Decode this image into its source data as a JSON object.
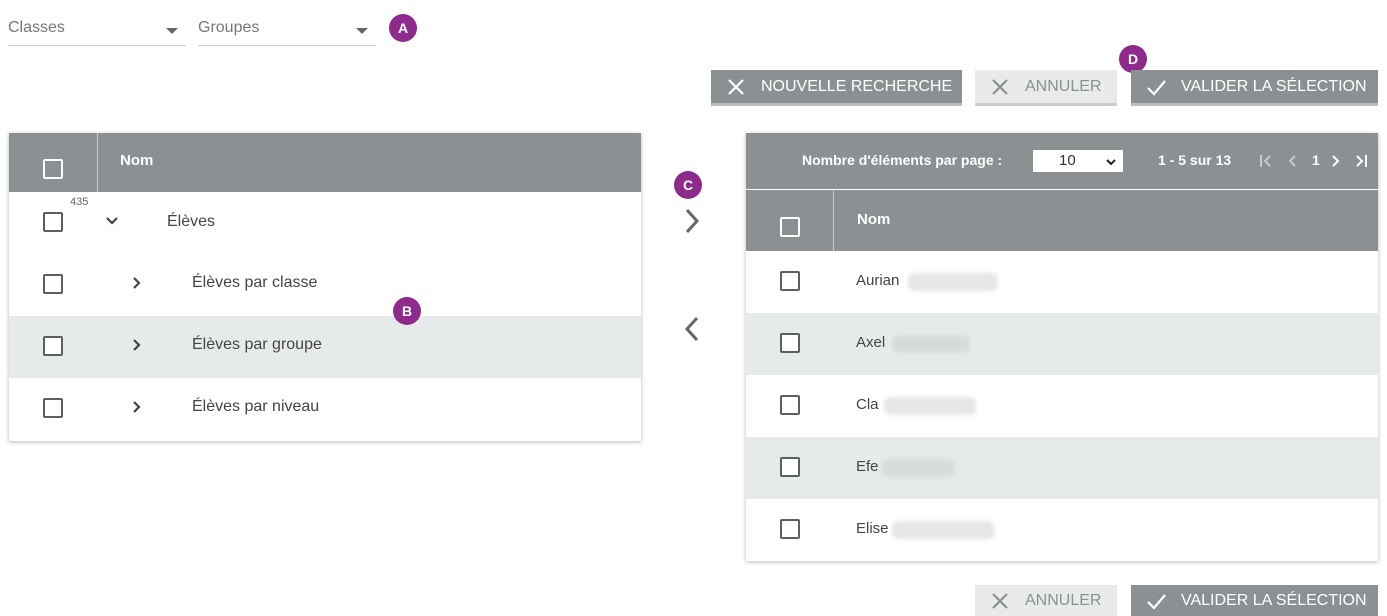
{
  "filters": {
    "classes_label": "Classes",
    "groupes_label": "Groupes"
  },
  "badges": {
    "a": "A",
    "b": "B",
    "c": "C",
    "d": "D"
  },
  "toolbar": {
    "new_search_label": "NOUVELLE RECHERCHE",
    "cancel_label": "ANNULER",
    "validate_label": "VALIDER LA SÉLECTION"
  },
  "tree": {
    "header_nom": "Nom",
    "count": "435",
    "rows": [
      {
        "label": "Élèves"
      },
      {
        "label": "Élèves par classe"
      },
      {
        "label": "Élèves par groupe"
      },
      {
        "label": "Élèves par niveau"
      }
    ]
  },
  "selection": {
    "per_page_label": "Nombre d'éléments par page :",
    "per_page_value": "10",
    "range_label": "1 - 5 sur 13",
    "current_page": "1",
    "header_nom": "Nom",
    "rows": [
      {
        "name": "Aurian"
      },
      {
        "name": "Axel"
      },
      {
        "name": "Cla"
      },
      {
        "name": "Efe"
      },
      {
        "name": "Elise"
      }
    ]
  },
  "footer": {
    "cancel_label": "ANNULER",
    "validate_label": "VALIDER LA SÉLECTION"
  },
  "colors": {
    "header_gray": "#8b9193",
    "badge_purple": "#8e2a8c",
    "row_alt": "#e7eaeb"
  }
}
